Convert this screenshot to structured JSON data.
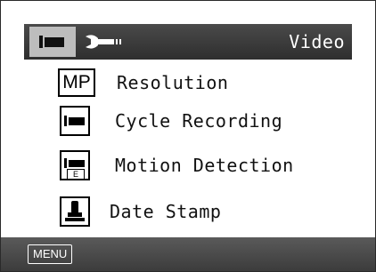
{
  "header": {
    "title": "Video",
    "tabs": [
      {
        "icon": "video-camera-icon",
        "active": true
      },
      {
        "icon": "wrench-icon",
        "active": false
      }
    ]
  },
  "menu": {
    "items": [
      {
        "icon": "mp-icon",
        "icon_text": "MP",
        "label": "Resolution"
      },
      {
        "icon": "video-camera-icon",
        "label": "Cycle Recording"
      },
      {
        "icon": "motion-detection-icon",
        "icon_text": "E",
        "label": "Motion Detection"
      },
      {
        "icon": "stamp-icon",
        "label": "Date Stamp"
      }
    ]
  },
  "footer": {
    "menu_label": "MENU"
  },
  "colors": {
    "header_bg": "#363636",
    "active_tab_bg": "#bdbdbd",
    "footer_bg": "#474747",
    "text": "#111111"
  }
}
